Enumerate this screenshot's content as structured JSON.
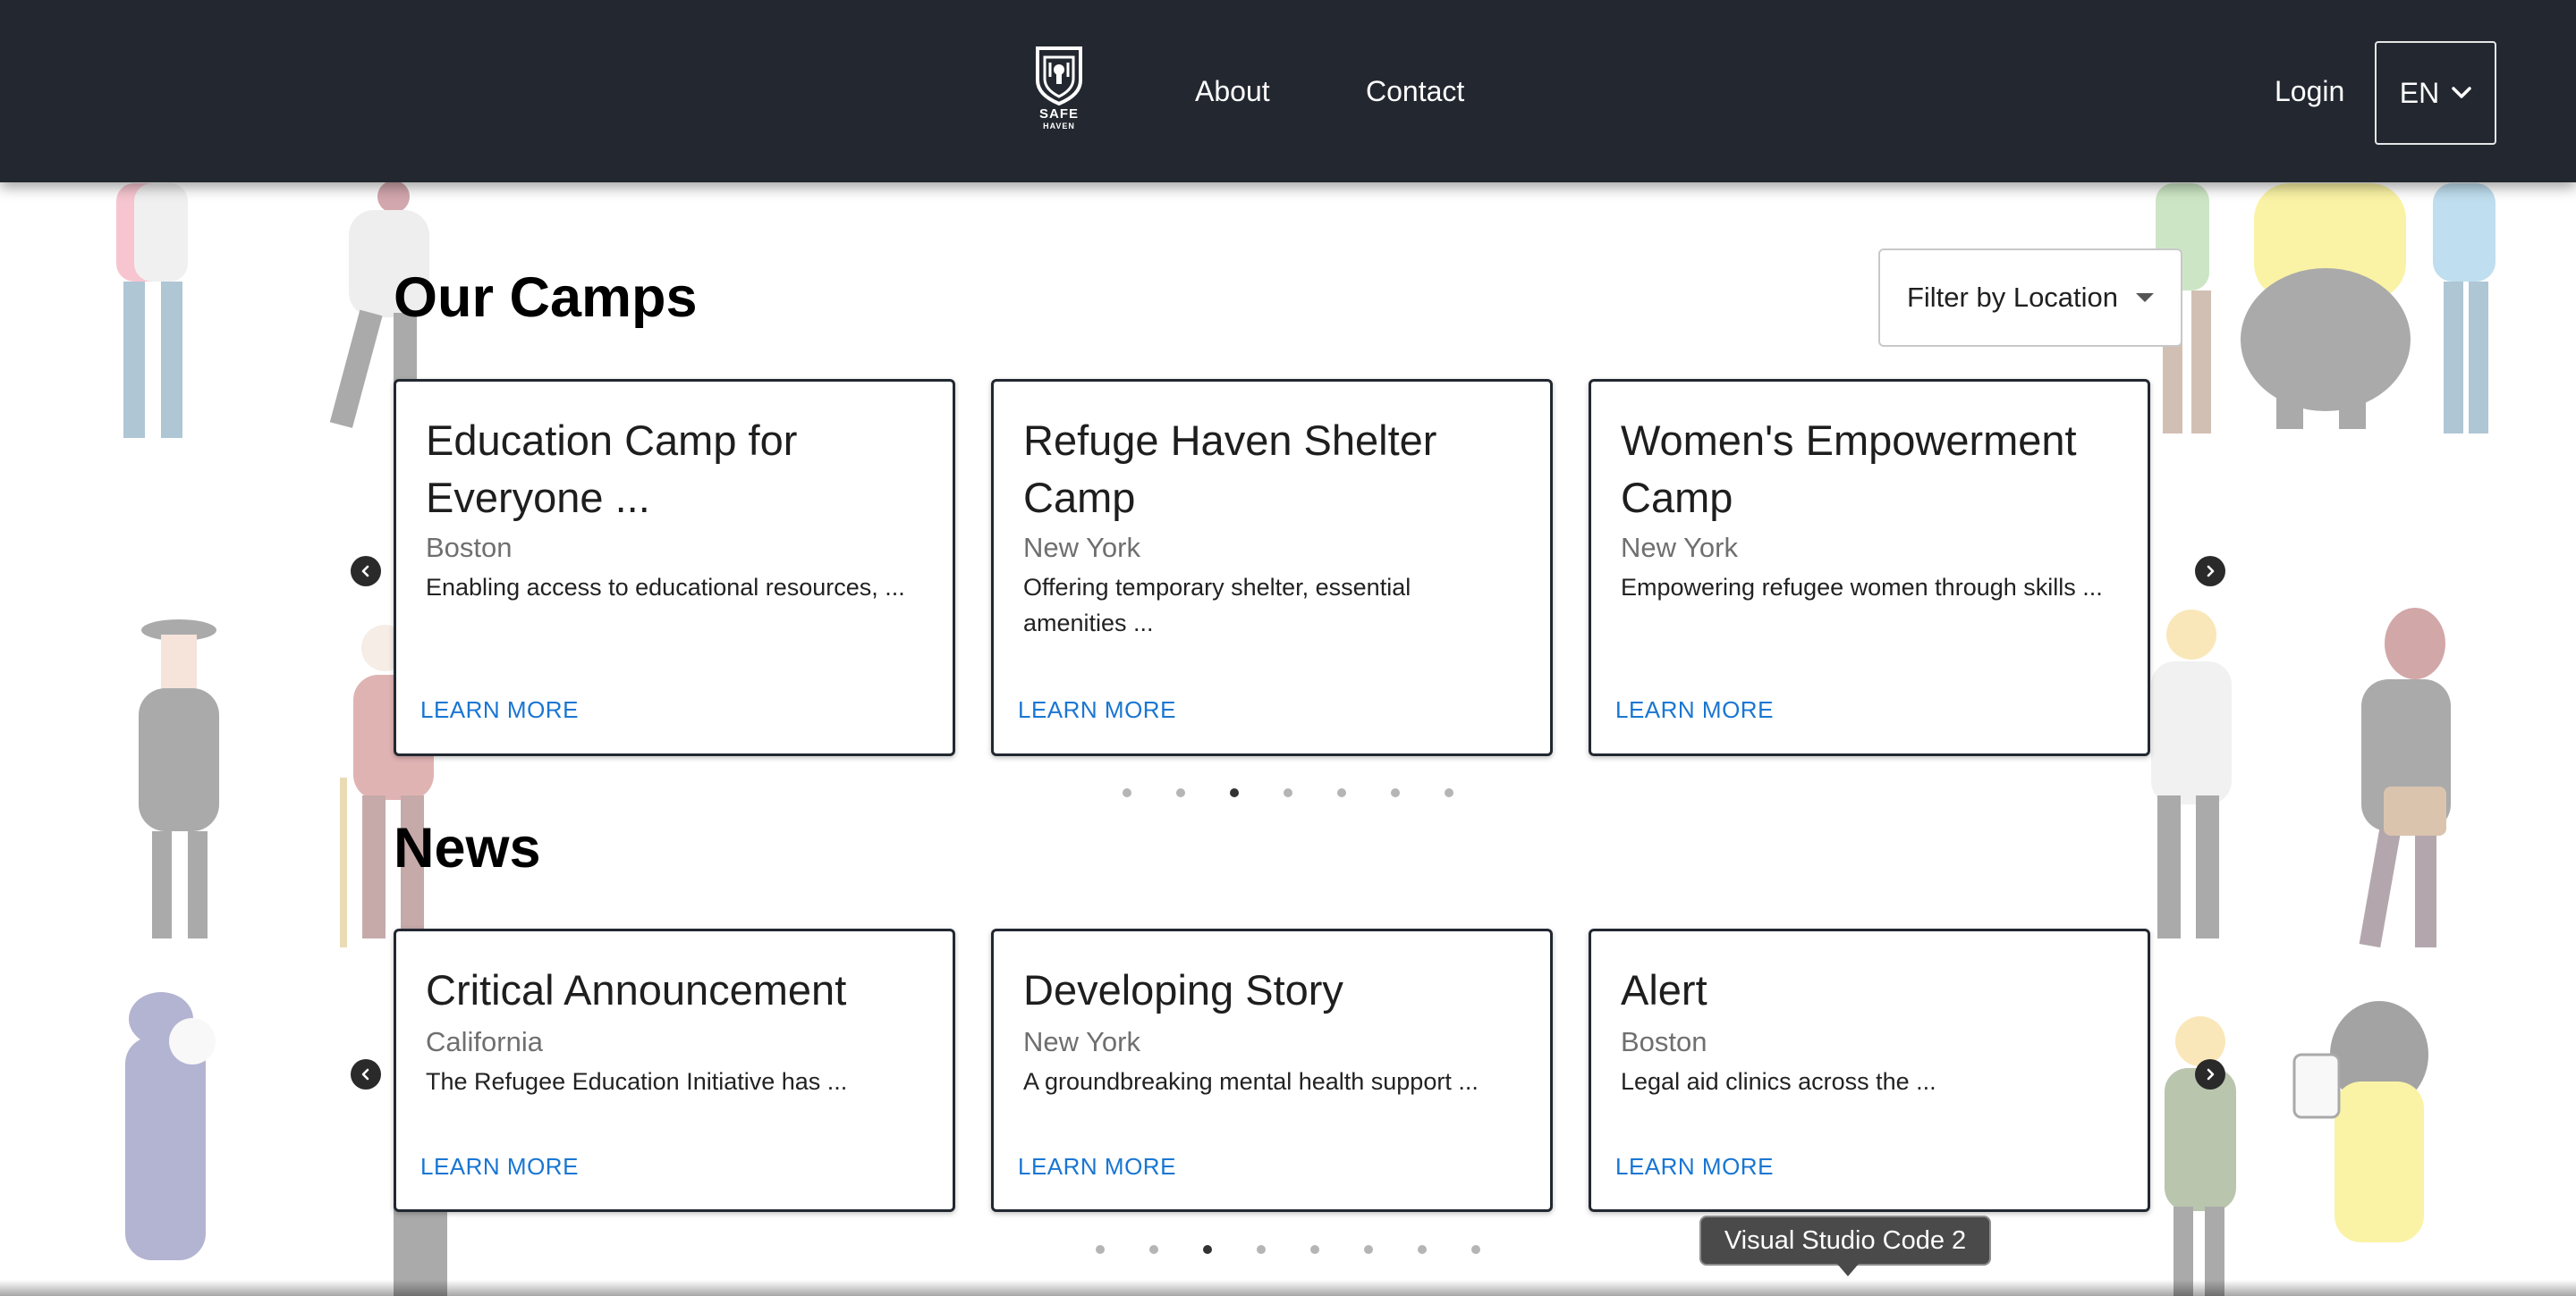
{
  "navbar": {
    "logo_word": "SAFE",
    "logo_sub": "HAVEN",
    "links": {
      "about": "About",
      "contact": "Contact"
    },
    "login": "Login",
    "language": "EN"
  },
  "camps": {
    "title": "Our Camps",
    "filter_label": "Filter by Location",
    "cards": [
      {
        "title": "Education Camp for Everyone ...",
        "location": "Boston",
        "description": "Enabling access to educational resources, ...",
        "cta": "LEARN MORE"
      },
      {
        "title": "Refuge Haven Shelter Camp",
        "location": "New York",
        "description": "Offering temporary shelter, essential amenities ...",
        "cta": "LEARN MORE"
      },
      {
        "title": "Women's Empowerment Camp",
        "location": "New York",
        "description": "Empowering refugee women through skills ...",
        "cta": "LEARN MORE"
      }
    ],
    "pagination": {
      "total": 7,
      "active_index": 2
    }
  },
  "news": {
    "title": "News",
    "cards": [
      {
        "title": "Critical Announcement",
        "location": "California",
        "description": "The Refugee Education Initiative has ...",
        "cta": "LEARN MORE"
      },
      {
        "title": "Developing Story",
        "location": "New York",
        "description": "A groundbreaking mental health support ...",
        "cta": "LEARN MORE"
      },
      {
        "title": "Alert",
        "location": "Boston",
        "description": "Legal aid clinics across the ...",
        "cta": "LEARN MORE"
      }
    ],
    "pagination": {
      "total": 8,
      "active_index": 2
    }
  },
  "tooltip": {
    "text": "Visual Studio Code 2"
  },
  "colors": {
    "navbar_bg": "#232830",
    "link_blue": "#1976d2",
    "card_border": "#222831"
  },
  "icons": {
    "logo": "shield-logo-icon",
    "language_caret": "chevron-down-icon",
    "filter_caret": "caret-down-icon",
    "carousel_prev": "chevron-left-icon",
    "carousel_next": "chevron-right-icon"
  }
}
